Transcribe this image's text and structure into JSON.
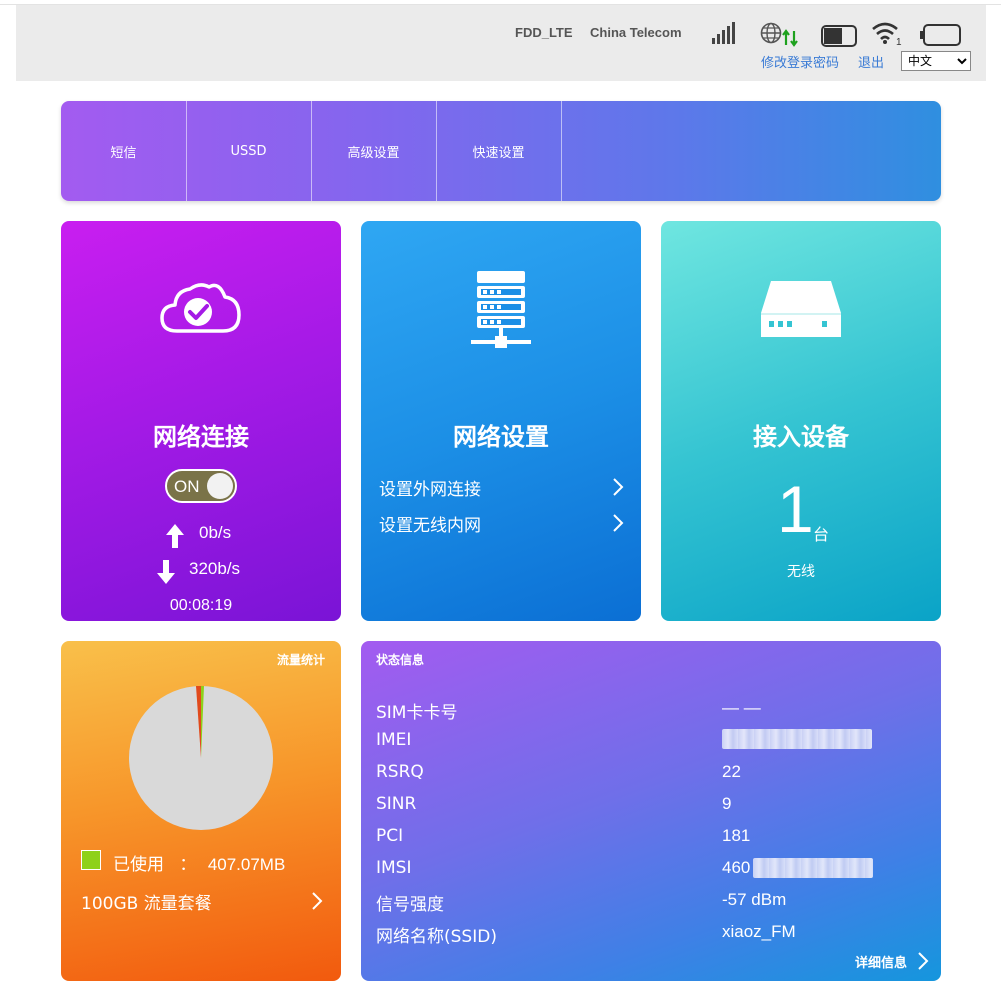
{
  "header": {
    "network_type": "FDD_LTE",
    "carrier": "China Telecom",
    "wifi_client_count": "1",
    "change_password": "修改登录密码",
    "logout": "退出",
    "language_selected": "中文"
  },
  "nav": {
    "items": [
      {
        "label": "短信"
      },
      {
        "label": "USSD"
      },
      {
        "label": "高级设置"
      },
      {
        "label": "快速设置"
      }
    ]
  },
  "connection": {
    "title": "网络连接",
    "toggle": "ON",
    "upload": "0b/s",
    "download": "320b/s",
    "uptime": "00:08:19"
  },
  "settings": {
    "title": "网络设置",
    "links": [
      {
        "label": "设置外网连接"
      },
      {
        "label": "设置无线内网"
      }
    ]
  },
  "devices": {
    "title": "接入设备",
    "count": "1",
    "unit": "台",
    "type": "无线"
  },
  "traffic": {
    "title": "流量统计",
    "used_label": "已使用",
    "separator": "：",
    "used_value": "407.07MB",
    "plan": "100GB 流量套餐"
  },
  "status": {
    "title": "状态信息",
    "rows": [
      {
        "label": "SIM卡卡号",
        "value": "— —"
      },
      {
        "label": "IMEI",
        "value": ""
      },
      {
        "label": "RSRQ",
        "value": "22"
      },
      {
        "label": "SINR",
        "value": "9"
      },
      {
        "label": "PCI",
        "value": "181"
      },
      {
        "label": "IMSI",
        "value": "460"
      },
      {
        "label": "信号强度",
        "value": "-57 dBm"
      },
      {
        "label": "网络名称(SSID)",
        "value": "xiaoz_FM"
      }
    ],
    "details": "详细信息"
  },
  "colors": {
    "link": "#3a7bd5",
    "legend_used": "#8ed11a",
    "pie_remaining": "#d9d9d9"
  }
}
